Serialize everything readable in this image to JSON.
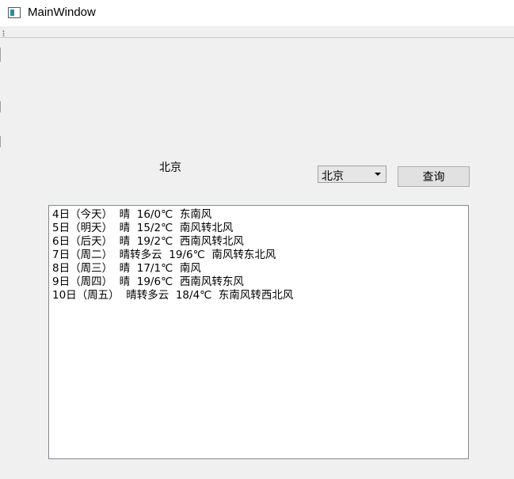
{
  "window": {
    "title": "MainWindow"
  },
  "city_label": "北京",
  "city_select": {
    "value": "北京"
  },
  "query_button": {
    "label": "查询"
  },
  "forecast_lines": [
    "4日（今天）  晴  16/0℃  东南风",
    "5日（明天）  晴  15/2℃  南风转北风",
    "6日（后天）  晴  19/2℃  西南风转北风",
    "7日（周二）  晴转多云  19/6℃  南风转东北风",
    "8日（周三）  晴  17/1℃  南风",
    "9日（周四）  晴  19/6℃  西南风转东风",
    "10日（周五）  晴转多云  18/4℃  东南风转西北风"
  ]
}
